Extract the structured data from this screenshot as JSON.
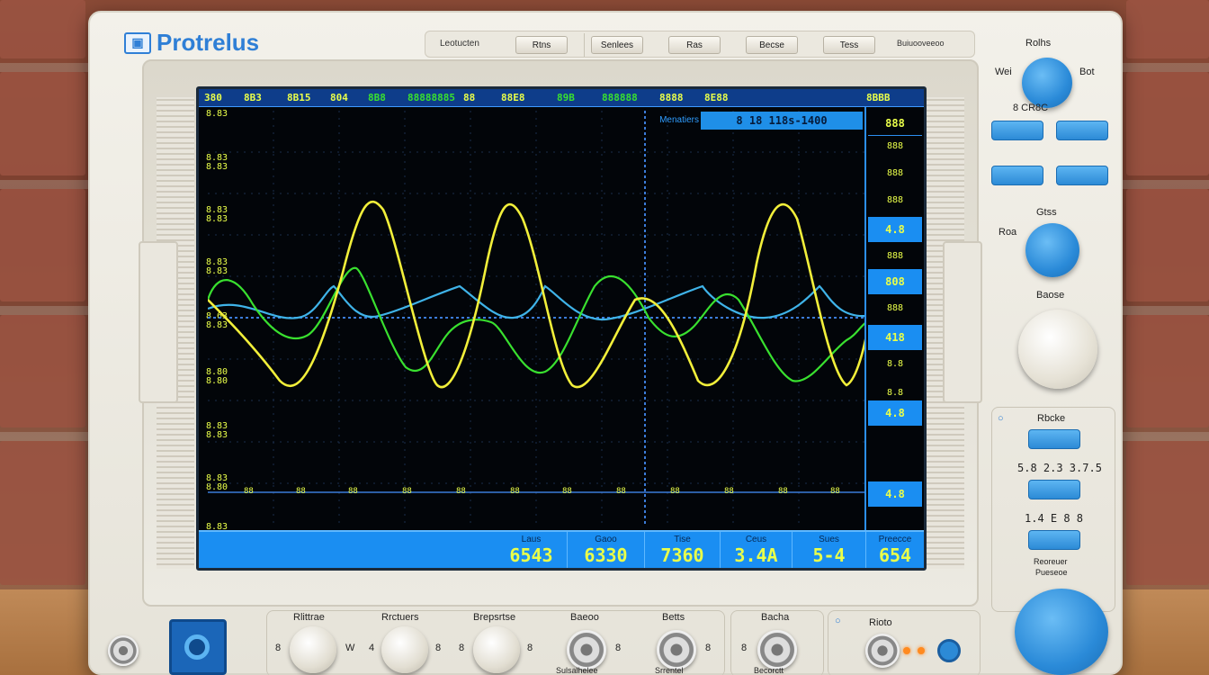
{
  "brand": {
    "name": "Protrelus",
    "logo_text": "▣"
  },
  "topbar": {
    "label_left": "Leotucten",
    "buttons": [
      "Rtns",
      "Senlees",
      "Ras",
      "Becse",
      "Tess"
    ],
    "label_right": "Buiuooveeoo"
  },
  "screen": {
    "header": [
      "380",
      "8B3",
      "8B15",
      "804",
      "8B8",
      "88888885",
      "88",
      "88E8",
      "89B",
      "888888",
      "8888",
      "8E88",
      "8BBB"
    ],
    "y_labels": [
      "8.83",
      "8.83\n8.83",
      "8.83\n8.83",
      "8.83\n8.83",
      "8.63\n8.83",
      "8.80\n8.80",
      "8.83\n8.83",
      "8.83\n8.80",
      "8.83\n8.83"
    ],
    "measure_label": "Menatiers",
    "measure_value": "8 18 118s-1400",
    "x_ticks": [
      "88",
      "88",
      "88",
      "88",
      "88",
      "88",
      "88",
      "88",
      "88",
      "88",
      "88",
      "88"
    ],
    "side_items": [
      {
        "text": "888",
        "style": "lo"
      },
      {
        "text": "888",
        "style": "small"
      },
      {
        "text": "888",
        "style": "small"
      },
      {
        "text": "888",
        "style": "small"
      },
      {
        "text": "4.8",
        "style": "hi"
      },
      {
        "text": "888",
        "style": "small"
      },
      {
        "text": "808",
        "style": "hi"
      },
      {
        "text": "888",
        "style": "small"
      },
      {
        "text": "418",
        "style": "hi"
      },
      {
        "text": "8.8",
        "style": "small"
      },
      {
        "text": "8.8",
        "style": "small"
      },
      {
        "text": "4.8",
        "style": "hi"
      },
      {
        "text": "4.8",
        "style": "hi"
      }
    ],
    "footer_label": "",
    "footer": [
      {
        "key": "Laus",
        "value": "6543"
      },
      {
        "key": "Gaoo",
        "value": "6330"
      },
      {
        "key": "Tise",
        "value": "7360"
      },
      {
        "key": "Ceus",
        "value": "3.4A"
      },
      {
        "key": "Sues",
        "value": "5-4"
      },
      {
        "key": "Preecce",
        "value": "654"
      }
    ]
  },
  "right_panel": {
    "top_label": "Rolhs",
    "knob1_left": "Wei",
    "knob1_right": "Bot",
    "btn_row_label": "8 CR8C",
    "gain_label": "Gtss",
    "gain_left": "Roa",
    "mode_label": "Baose",
    "group_label": "Rbcke",
    "readout1": "5.8 2.3 3.7.5",
    "readout2": "1.4 E 8 8",
    "bottom_label": "Reoreuer",
    "bottom_label2": "Pueseoe"
  },
  "bottom_panel": {
    "knobs": [
      {
        "label": "Rlittrae",
        "left": "8",
        "right": "W"
      },
      {
        "label": "Rrctuers",
        "left": "4",
        "right": "8"
      },
      {
        "label": "Brepsrtse",
        "left": "8",
        "right": "8"
      }
    ],
    "jacks": [
      {
        "label": "Baeoo",
        "sub": "Sulsalhelee"
      },
      {
        "label": "Betts",
        "sub": "Srrentel"
      },
      {
        "label": "Bacha",
        "sub": "Becorctt"
      },
      {
        "label": "Rioto",
        "sub": ""
      }
    ],
    "jack_letters": [
      "8",
      "8",
      "8",
      "8"
    ]
  },
  "colors": {
    "accent": "#2f7fd6",
    "trace_yellow": "#f2ef3a",
    "trace_green": "#39e02f",
    "trace_cyan": "#3fb3e8",
    "screen_bg": "#020509",
    "panel_blue": "#1a8ef2"
  }
}
